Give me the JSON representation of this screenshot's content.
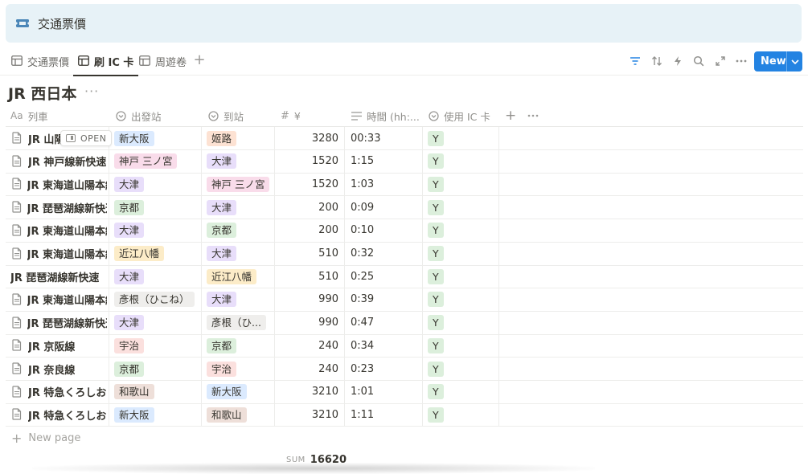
{
  "banner": {
    "title": "交通票價"
  },
  "tabs": [
    {
      "label": "交通票價",
      "active": false
    },
    {
      "label": "刷 IC 卡",
      "active": true
    },
    {
      "label": "周遊卷",
      "active": false
    }
  ],
  "toolbar": {
    "new_label": "New"
  },
  "db_title": "JR 西日本",
  "columns": {
    "name": "列車",
    "name_type": "Aa",
    "from": "出發站",
    "to": "到站",
    "price": "¥",
    "price_type": "#",
    "time": "時間 (hh:...",
    "ic": "使用 IC 卡"
  },
  "open_label": "OPEN",
  "rows": [
    {
      "name": "JR 山陽",
      "from": "新大阪",
      "from_color": "#dbeafe",
      "to": "姬路",
      "to_color": "#fde2d3",
      "price": "3280",
      "time": "00:33",
      "ic": "Y",
      "show_icon": true
    },
    {
      "name": "JR 神戸線新快速",
      "from": "神戸 三ノ宮",
      "from_color": "#f9dcea",
      "to": "大津",
      "to_color": "#e8defa",
      "price": "1520",
      "time": "1:15",
      "ic": "Y",
      "show_icon": true
    },
    {
      "name": "JR 東海道山陽本線",
      "from": "大津",
      "from_color": "#e8defa",
      "to": "神戸 三ノ宮",
      "to_color": "#f9dcea",
      "price": "1520",
      "time": "1:03",
      "ic": "Y",
      "show_icon": true
    },
    {
      "name": "JR 琵琶湖線新快速",
      "from": "京都",
      "from_color": "#dcefdc",
      "to": "大津",
      "to_color": "#e8defa",
      "price": "200",
      "time": "0:09",
      "ic": "Y",
      "show_icon": true
    },
    {
      "name": "JR 東海道山陽本線",
      "from": "大津",
      "from_color": "#e8defa",
      "to": "京都",
      "to_color": "#dcefdc",
      "price": "200",
      "time": "0:10",
      "ic": "Y",
      "show_icon": true
    },
    {
      "name": "JR 東海道山陽本線",
      "from": "近江八幡",
      "from_color": "#fcecc8",
      "to": "大津",
      "to_color": "#e8defa",
      "price": "510",
      "time": "0:32",
      "ic": "Y",
      "show_icon": true
    },
    {
      "name": "JR 琵琶湖線新快速",
      "from": "大津",
      "from_color": "#e8defa",
      "to": "近江八幡",
      "to_color": "#fcecc8",
      "price": "510",
      "time": "0:25",
      "ic": "Y",
      "show_icon": false
    },
    {
      "name": "JR 東海道山陽本線",
      "from": "彥根（ひこね）",
      "from_color": "#efeeec",
      "to": "大津",
      "to_color": "#e8defa",
      "price": "990",
      "time": "0:39",
      "ic": "Y",
      "show_icon": true
    },
    {
      "name": "JR 琵琶湖線新快速",
      "from": "大津",
      "from_color": "#e8defa",
      "to": "彥根（ひ...",
      "to_color": "#efeeec",
      "price": "990",
      "time": "0:47",
      "ic": "Y",
      "show_icon": true
    },
    {
      "name": "JR 京阪線",
      "from": "宇治",
      "from_color": "#fbe0de",
      "to": "京都",
      "to_color": "#dcefdc",
      "price": "240",
      "time": "0:34",
      "ic": "Y",
      "show_icon": true
    },
    {
      "name": "JR 奈良線",
      "from": "京都",
      "from_color": "#dcefdc",
      "to": "宇治",
      "to_color": "#fbe0de",
      "price": "240",
      "time": "0:23",
      "ic": "Y",
      "show_icon": true
    },
    {
      "name": "JR 特急くろしお",
      "from": "和歌山",
      "from_color": "#eedfd9",
      "to": "新大阪",
      "to_color": "#dbeafe",
      "price": "3210",
      "time": "1:01",
      "ic": "Y",
      "show_icon": true
    },
    {
      "name": "JR 特急くろしお",
      "from": "新大阪",
      "from_color": "#dbeafe",
      "to": "和歌山",
      "to_color": "#eedfd9",
      "price": "3210",
      "time": "1:11",
      "ic": "Y",
      "show_icon": true
    }
  ],
  "ic_tag_color": "#dcefdc",
  "new_page_label": "New page",
  "sum_label": "SUM",
  "sum_value": "16620"
}
